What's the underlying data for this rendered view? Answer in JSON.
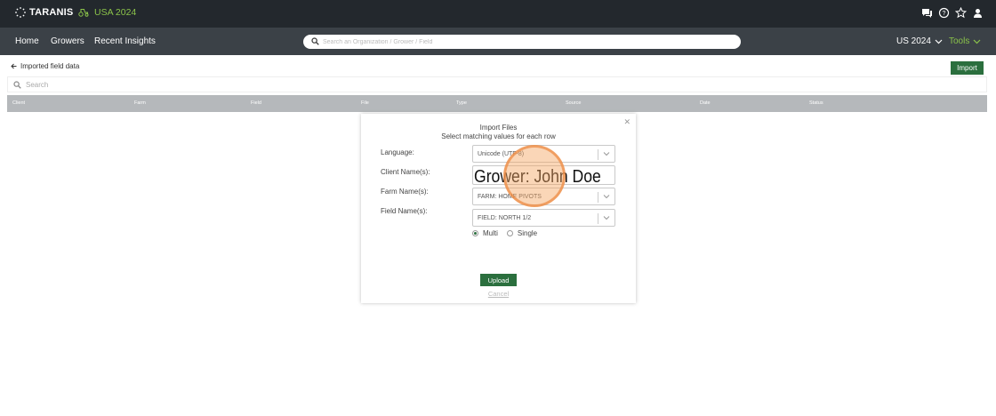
{
  "app": {
    "logo_text": "TARANIS",
    "season": "USA 2024"
  },
  "topbar": {
    "icons": [
      "chat-icon",
      "help-icon",
      "star-icon",
      "user-icon"
    ]
  },
  "nav": {
    "items": [
      {
        "label": "Home"
      },
      {
        "label": "Growers"
      },
      {
        "label": "Recent Insights"
      }
    ],
    "search_placeholder": "Search an Organization / Grower / Field",
    "region": "US 2024",
    "tools": "Tools"
  },
  "page": {
    "back_label": "Imported field data",
    "import_label": "Import",
    "search_placeholder": "Search",
    "columns": [
      "Client",
      "Farm",
      "Field",
      "File",
      "Type",
      "Source",
      "Date",
      "Status"
    ]
  },
  "modal": {
    "title": "Import Files",
    "subtitle": "Select matching values for each row",
    "fields": [
      {
        "label": "Language:",
        "value": "Unicode (UTF-8)"
      },
      {
        "label": "Client Name(s):",
        "value": "Grower: John Doe"
      },
      {
        "label": "Farm Name(s):",
        "value": "FARM: HOME PIVOTS"
      },
      {
        "label": "Field Name(s):",
        "value": "FIELD: NORTH 1/2"
      }
    ],
    "radio_options": [
      {
        "label": "Multi",
        "selected": true
      },
      {
        "label": "Single",
        "selected": false
      }
    ],
    "upload_label": "Upload",
    "cancel_label": "Cancel"
  },
  "colors": {
    "topbar": "#23282d",
    "navbar": "#3b4147",
    "accent_green": "#2b6f3e",
    "lime": "#8bc34a",
    "table_header": "#b5b8bb",
    "highlight": "#f4a460"
  }
}
